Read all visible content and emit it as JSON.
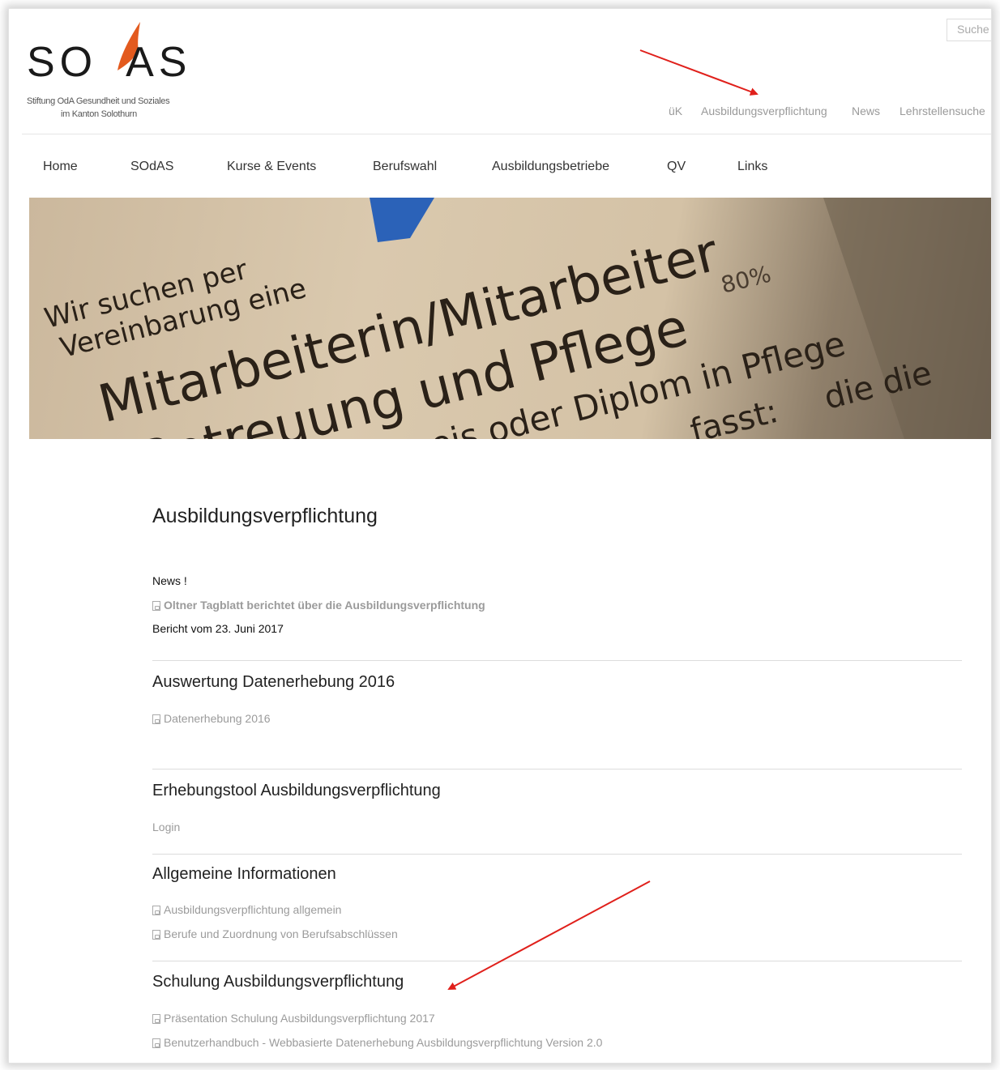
{
  "header": {
    "logo": {
      "word_left": "SO",
      "word_mark": "d",
      "word_right": "AS",
      "line1": "Stiftung OdA Gesundheit und Soziales",
      "line2": "im Kanton Solothurn"
    },
    "search_placeholder": "Suche",
    "top_nav": [
      "üK",
      "Ausbildungsverpflichtung",
      "News",
      "Lehrstellensuche"
    ]
  },
  "main_nav": [
    "Home",
    "SOdAS",
    "Kurse & Events",
    "Berufswahl",
    "Ausbildungsbetriebe",
    "QV",
    "Links"
  ],
  "hero": {
    "lines": [
      "Wir suchen per",
      "Vereinbarung eine",
      "Mitarbeiterin/Mitarbeiter",
      "Betreuung und Pflege",
      "80%",
      "Fachausweis oder Diplom in Pflege",
      "fasst:",
      "die die"
    ]
  },
  "page": {
    "title": "Ausbildungsverpflichtung",
    "news_heading": "News !",
    "news_link": "Oltner Tagblatt berichtet über die Ausbildungsverpflichtung",
    "news_date": "Bericht vom 23. Juni 2017",
    "sections": [
      {
        "title": "Auswertung Datenerhebung 2016",
        "links": [
          "Datenerhebung 2016"
        ]
      },
      {
        "title": "Erhebungstool Ausbildungsverpflichtung",
        "links": [
          "Login"
        ]
      },
      {
        "title": "Allgemeine Informationen",
        "links": [
          "Ausbildungsverpflichtung allgemein",
          "Berufe und Zuordnung von Berufsabschlüssen"
        ]
      },
      {
        "title": "Schulung Ausbildungsverpflichtung",
        "links": [
          "Präsentation Schulung Ausbildungsverpflichtung 2017",
          "Benutzerhandbuch - Webbasierte Datenerhebung Ausbildungsverpflichtung Version 2.0"
        ]
      }
    ]
  },
  "colors": {
    "logo_accent": "#e35a1e",
    "annotation_arrow": "#e0201b",
    "link_gray": "#9b9b9b"
  }
}
